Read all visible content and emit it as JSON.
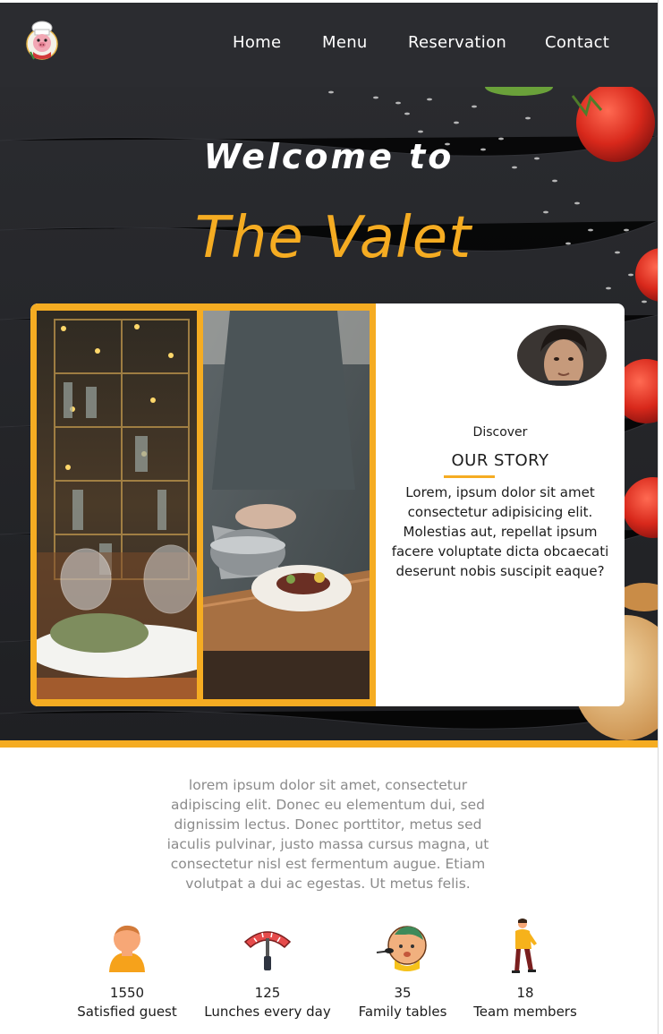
{
  "nav": {
    "logo_icon": "chef-pig-logo-icon",
    "links": [
      {
        "label": "Home"
      },
      {
        "label": "Menu"
      },
      {
        "label": "Reservation"
      },
      {
        "label": "Contact"
      }
    ]
  },
  "hero": {
    "welcome": "Welcome to",
    "brand": "The Valet",
    "accent_color": "#f5ac22"
  },
  "story": {
    "eyebrow": "Discover",
    "title": "OUR STORY",
    "text": "Lorem, ipsum dolor sit amet consectetur adipisicing elit. Molestias aut, repellat ipsum facere voluptate dicta obcaecati deserunt nobis suscipit eaque?"
  },
  "about": {
    "text": "lorem ipsum dolor sit amet, consectetur adipiscing elit. Donec eu elementum dui, sed dignissim lectus. Donec porttitor, metus sed iaculis pulvinar, justo massa cursus magna, ut consectetur nisl est fermentum augue. Etiam volutpat a dui ac egestas. Ut metus felis."
  },
  "stats": [
    {
      "icon": "guest-icon",
      "number": "1550",
      "label": "Satisfied guest"
    },
    {
      "icon": "sausage-fork-icon",
      "number": "125",
      "label": "Lunches every day"
    },
    {
      "icon": "baby-chef-icon",
      "number": "35",
      "label": "Family tables"
    },
    {
      "icon": "team-member-icon",
      "number": "18",
      "label": "Team members"
    }
  ]
}
